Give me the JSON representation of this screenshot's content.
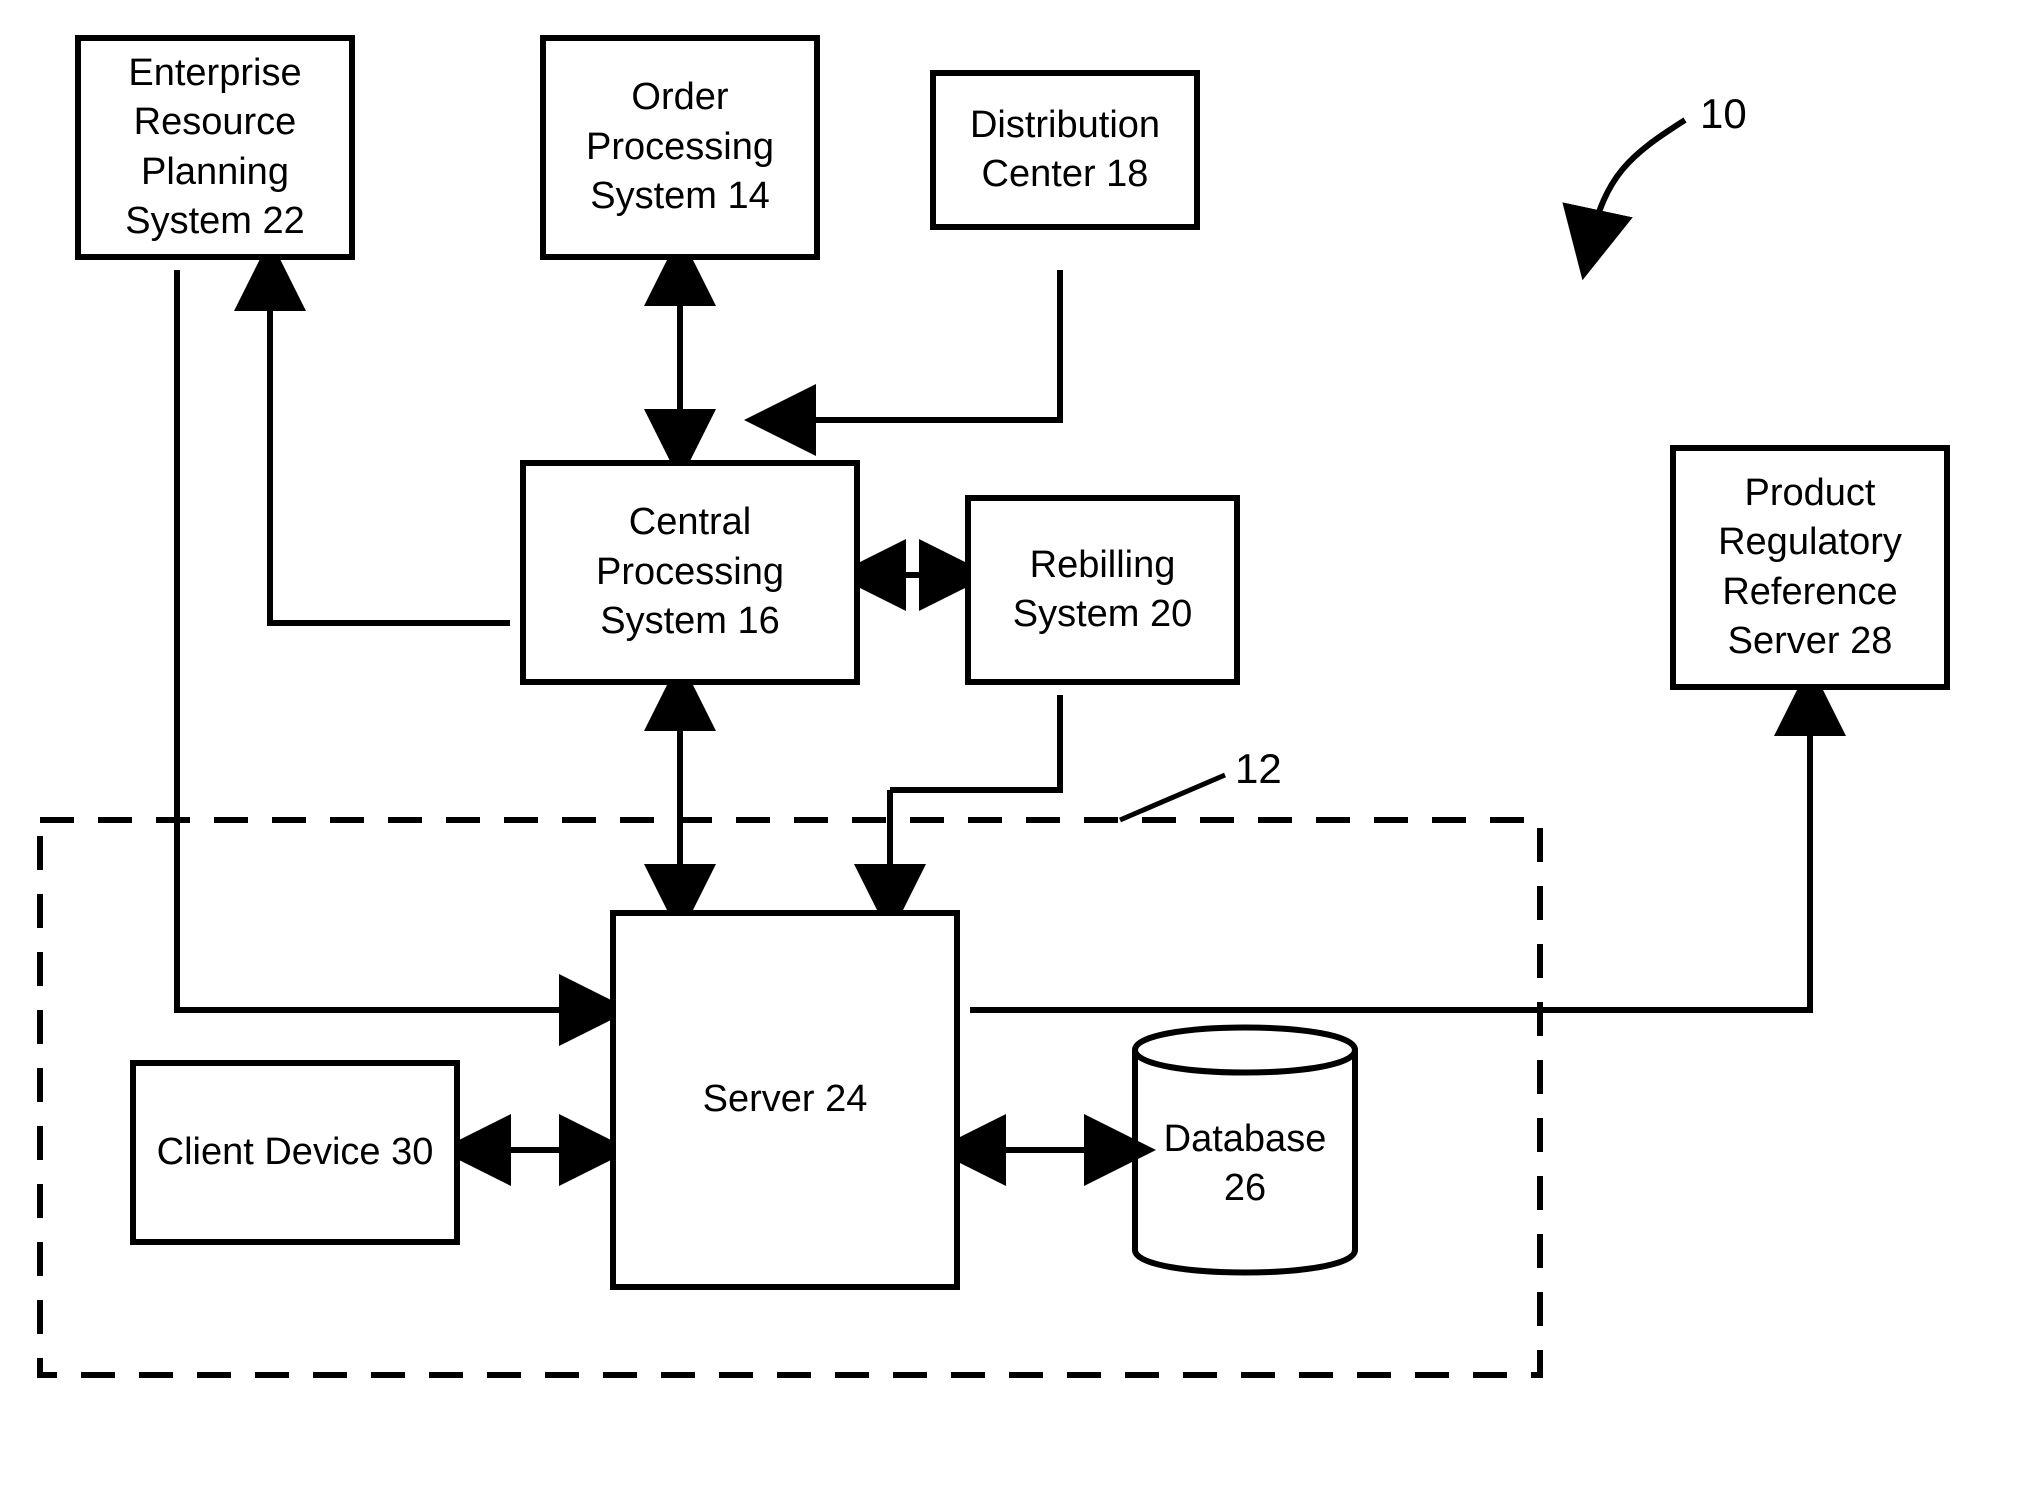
{
  "boxes": {
    "erp": "Enterprise Resource Planning System 22",
    "order": "Order Processing System 14",
    "dist": "Distribution Center 18",
    "central": "Central Processing System 16",
    "rebill": "Rebilling System 20",
    "product": "Product Regulatory Reference Server 28",
    "client": "Client Device 30",
    "server": "Server 24",
    "database": "Database 26"
  },
  "refs": {
    "figure": "10",
    "group": "12"
  }
}
